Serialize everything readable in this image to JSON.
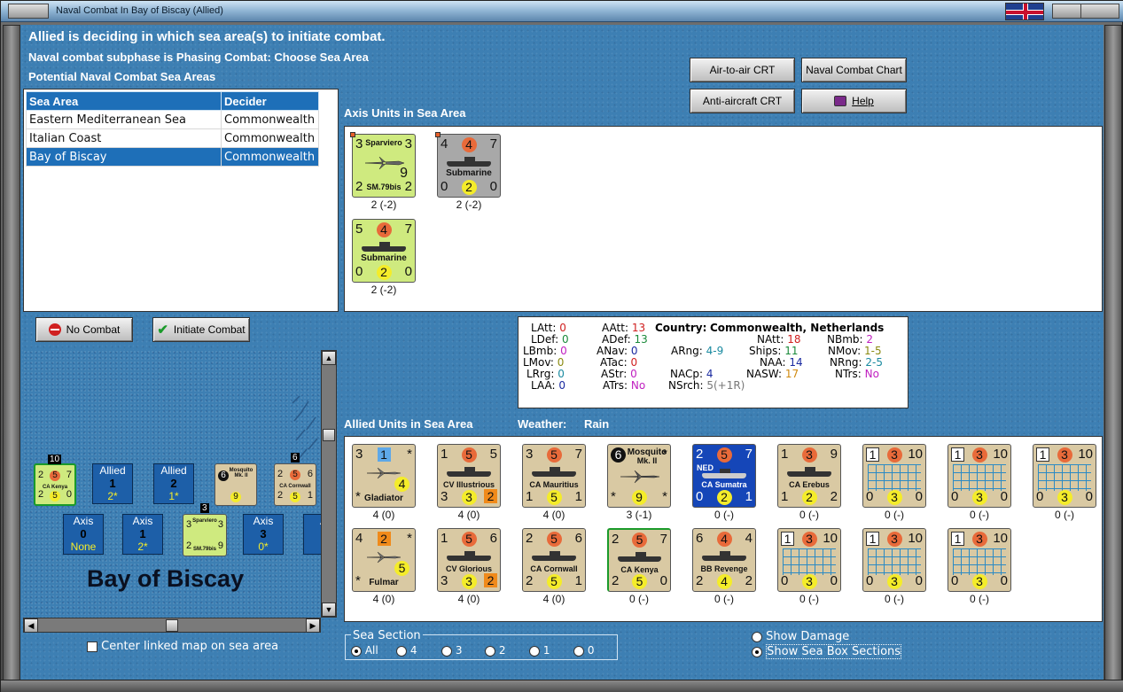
{
  "window": {
    "title": "Naval Combat In Bay of Biscay (Allied)"
  },
  "status": {
    "main": "Allied is deciding in which sea area(s) to initiate combat.",
    "subphase": "Naval combat subphase is Phasing Combat: Choose Sea Area",
    "potential": "Potential Naval Combat Sea Areas"
  },
  "buttons": {
    "air_crt": "Air-to-air CRT",
    "naval_chart": "Naval Combat Chart",
    "aa_crt": "Anti-aircraft CRT",
    "help": "Help",
    "no_combat": "No Combat",
    "initiate": "Initiate Combat"
  },
  "sea_table": {
    "headers": [
      "Sea Area",
      "Decider"
    ],
    "rows": [
      {
        "area": "Eastern Mediterranean Sea",
        "decider": "Commonwealth"
      },
      {
        "area": "Italian Coast",
        "decider": "Commonwealth"
      },
      {
        "area": "Bay of Biscay",
        "decider": "Commonwealth"
      }
    ]
  },
  "axis": {
    "label": "Axis Units in Sea Area",
    "units": [
      {
        "tl": "3",
        "name_top": "Sparviero",
        "tr": "3",
        "mid": "9",
        "bl": "2",
        "name": "SM.79bis",
        "br": "2",
        "step": "2 (-2)"
      },
      {
        "tl": "4",
        "tm": "4",
        "tr": "7",
        "name": "Submarine",
        "bl": "0",
        "bm": "2",
        "br": "0",
        "step": "2 (-2)"
      },
      {
        "tl": "5",
        "tm": "4",
        "tr": "7",
        "name": "Submarine",
        "bl": "0",
        "bm": "2",
        "br": "0",
        "step": "2 (-2)"
      }
    ]
  },
  "info": {
    "country_label": "Country:",
    "country": "Commonwealth, Netherlands",
    "LAtt": "0",
    "LDef": "0",
    "LBmb": "0",
    "LMov": "0",
    "LRrg": "0",
    "LAA": "0",
    "AAtt": "13",
    "ADef": "13",
    "ANav": "0",
    "ATac": "0",
    "AStr": "0",
    "ATrs": "No",
    "ARng": "4-9",
    "NACp": "4",
    "NSrch": "5(+1R)",
    "NAtt": "18",
    "Ships": "11",
    "NAA": "14",
    "NASW": "17",
    "NBmb": "2",
    "NMov": "1-5",
    "NRng": "2-5",
    "NTrs": "No",
    "colors": {
      "red": "#d02020",
      "green": "#1a8a3a",
      "purple": "#c020c0",
      "navy": "#1a2aa0",
      "teal": "#1a8aa0",
      "orange": "#d08a10",
      "olive": "#8a8a10"
    }
  },
  "allied": {
    "label": "Allied Units in Sea Area",
    "weather_label": "Weather:",
    "weather": "Rain",
    "row1": [
      {
        "tl": "3",
        "tm": "1",
        "tr": "*",
        "name": "Gladiator",
        "bl": "*",
        "br": "4",
        "step": "4 (0)"
      },
      {
        "tl": "1",
        "tm": "5",
        "tr": "5",
        "name": "CV Illustrious",
        "bl": "3",
        "bm": "3",
        "br": "2",
        "step": "4 (0)"
      },
      {
        "tl": "3",
        "tm": "5",
        "tr": "7",
        "name": "CA Mauritius",
        "bl": "1",
        "bm": "5",
        "br": "1",
        "step": "4 (0)"
      },
      {
        "tl": "6",
        "name_top": "Mosquito",
        "name_top2": "Mk. II",
        "tr": "*",
        "bl": "*",
        "bm": "9",
        "br": "*",
        "step": "3 (-1)"
      },
      {
        "tl": "2",
        "tm": "5",
        "tr": "7",
        "nat": "NED",
        "name": "CA Sumatra",
        "bl": "0",
        "bm": "2",
        "br": "1",
        "step": "0 (-)"
      },
      {
        "tl": "1",
        "tm": "3",
        "tr": "9",
        "name": "CA Erebus",
        "bl": "1",
        "bm": "2",
        "br": "2",
        "step": "0 (-)"
      },
      {
        "tl": "1",
        "tm": "3",
        "tr": "10",
        "bl": "0",
        "bm": "3",
        "br": "0",
        "step": "0 (-)"
      },
      {
        "tl": "1",
        "tm": "3",
        "tr": "10",
        "bl": "0",
        "bm": "3",
        "br": "0",
        "step": "0 (-)"
      },
      {
        "tl": "1",
        "tm": "3",
        "tr": "10",
        "bl": "0",
        "bm": "3",
        "br": "0",
        "step": "0 (-)"
      }
    ],
    "row2": [
      {
        "tl": "4",
        "tm": "2",
        "tr": "*",
        "name": "Fulmar",
        "bl": "*",
        "br": "5",
        "step": "4 (0)"
      },
      {
        "tl": "1",
        "tm": "5",
        "tr": "6",
        "name": "CV Glorious",
        "bl": "3",
        "bm": "3",
        "br": "2",
        "step": "4 (0)"
      },
      {
        "tl": "2",
        "tm": "5",
        "tr": "6",
        "name": "CA Cornwall",
        "bl": "2",
        "bm": "5",
        "br": "1",
        "step": "4 (0)"
      },
      {
        "tl": "2",
        "tm": "5",
        "tr": "7",
        "name": "CA Kenya",
        "bl": "2",
        "bm": "5",
        "br": "0",
        "step": "0 (-)"
      },
      {
        "tl": "6",
        "tm": "4",
        "tr": "4",
        "name": "BB Revenge",
        "bl": "2",
        "bm": "4",
        "br": "2",
        "step": "0 (-)"
      },
      {
        "tl": "1",
        "tm": "3",
        "tr": "10",
        "bl": "0",
        "bm": "3",
        "br": "0",
        "step": "0 (-)"
      },
      {
        "tl": "1",
        "tm": "3",
        "tr": "10",
        "bl": "0",
        "bm": "3",
        "br": "0",
        "step": "0 (-)"
      },
      {
        "tl": "1",
        "tm": "3",
        "tr": "10",
        "bl": "0",
        "bm": "3",
        "br": "0",
        "step": "0 (-)"
      }
    ]
  },
  "minimap": {
    "area_name": "Bay of Biscay",
    "stack_count_1": "10",
    "stack_count_2": "6",
    "stack_count_3": "3",
    "kenya": {
      "tl": "2",
      "tm": "5",
      "tr": "7",
      "name": "CA Kenya",
      "bl": "2",
      "bm": "5",
      "br": "0"
    },
    "mosquito": {
      "tl": "6",
      "name": "Mosquito Mk. II",
      "bm": "9"
    },
    "cornwall": {
      "tl": "2",
      "tm": "5",
      "tr": "6",
      "name": "CA Cornwall",
      "bl": "2",
      "bm": "5",
      "br": "1"
    },
    "sparviero": {
      "tl": "3",
      "name_top": "Sparviero",
      "tr": "3",
      "bl": "2",
      "name": "SM.79bis",
      "br": "9"
    },
    "boxes": [
      {
        "side": "Allied",
        "num": "1",
        "sub": "2*"
      },
      {
        "side": "Allied",
        "num": "2",
        "sub": "1*"
      },
      {
        "side": "Axis",
        "num": "0",
        "sub": "None"
      },
      {
        "side": "Axis",
        "num": "1",
        "sub": "2*"
      },
      {
        "side": "Axis",
        "num": "3",
        "sub": "0*"
      },
      {
        "side": "A"
      }
    ]
  },
  "options": {
    "center_map": "Center linked map on sea area",
    "sea_section": "Sea Section",
    "sections": [
      "All",
      "4",
      "3",
      "2",
      "1",
      "0"
    ],
    "show_damage": "Show Damage",
    "show_boxes": "Show Sea Box Sections"
  }
}
